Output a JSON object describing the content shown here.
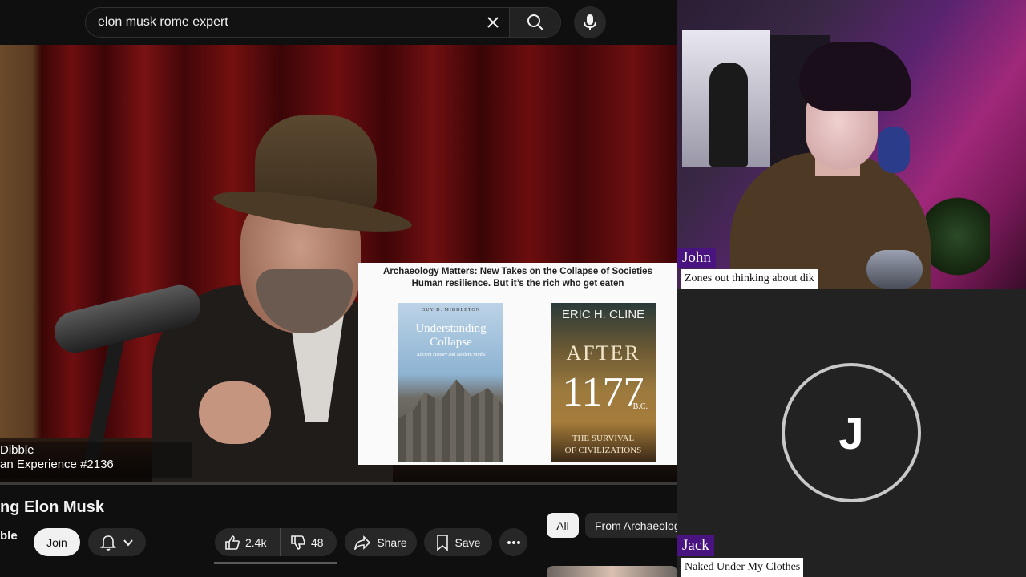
{
  "search": {
    "query": "elon musk rome expert"
  },
  "video": {
    "lower_third_name": "Dibble",
    "lower_third_episode": "an Experience #2136",
    "overlay_title_line1": "Archaeology Matters: New Takes on the Collapse of Societies",
    "overlay_title_line2": "Human resilience. But it’s the rich who get eaten",
    "book1": {
      "author": "GUY D. MIDDLETON",
      "title": "Understanding Collapse",
      "subtitle": "Ancient History and Modern Myths"
    },
    "book2": {
      "author": "ERIC H. CLINE",
      "title": "AFTER",
      "year": "1177",
      "era": "B.C.",
      "subtitle_line1": "THE SURVIVAL",
      "subtitle_line2": "OF CIVILIZATIONS"
    }
  },
  "metadata": {
    "title": "ng Elon Musk",
    "channel": "ble",
    "join_label": "Join",
    "like_count": "2.4k",
    "dislike_count": "48",
    "share_label": "Share",
    "save_label": "Save"
  },
  "chips": {
    "all": "All",
    "archaeology": "From Archaeolog"
  },
  "cameras": {
    "john": {
      "name": "John",
      "status": "Zones out thinking about dik"
    },
    "jack": {
      "name": "Jack",
      "initial": "J",
      "status": "Naked Under My Clothes"
    }
  },
  "colors": {
    "name_tag": "#4a1480",
    "yt_bg": "#0f0f0f",
    "chip_bg": "#272727"
  },
  "icons": [
    "close-icon",
    "search-icon",
    "mic-icon",
    "bell-icon",
    "chevron-down-icon",
    "thumbs-up-icon",
    "thumbs-down-icon",
    "share-icon",
    "bookmark-icon",
    "more-icon"
  ]
}
